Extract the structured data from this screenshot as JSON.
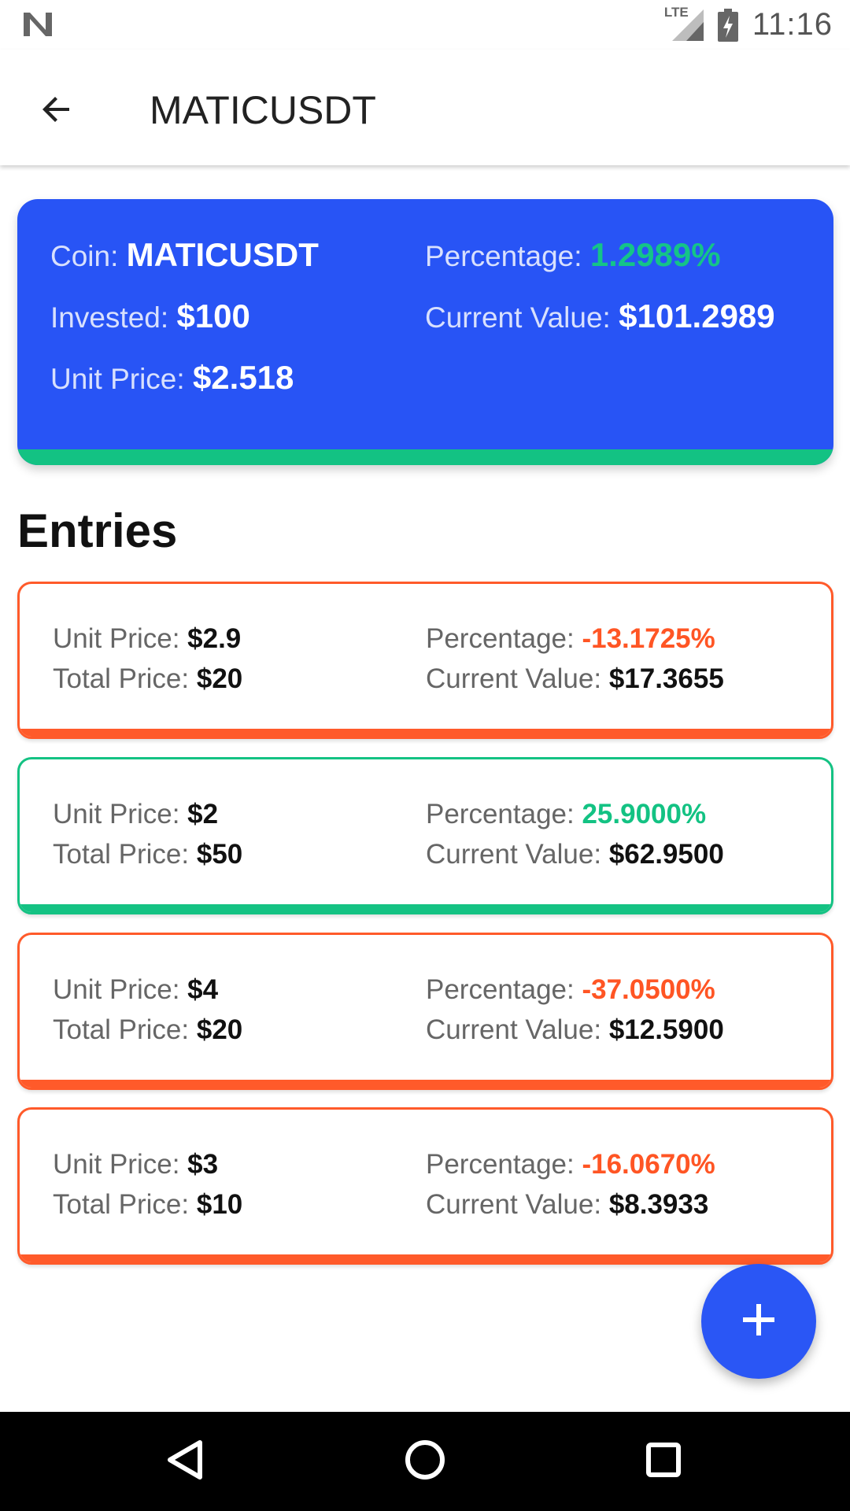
{
  "status_bar": {
    "time": "11:16",
    "network_label": "LTE",
    "icons": [
      "n-logo-icon",
      "signal-icon",
      "battery-charging-icon"
    ]
  },
  "app_bar": {
    "title": "MATICUSDT",
    "back_icon": "arrow-back-icon"
  },
  "summary": {
    "coin_label": "Coin: ",
    "coin_value": "MATICUSDT",
    "percentage_label": "Percentage: ",
    "percentage_value": "1.2989%",
    "invested_label": "Invested: ",
    "invested_value": "$100",
    "current_value_label": "Current Value: ",
    "current_value_value": "$101.2989",
    "unit_price_label": "Unit Price: ",
    "unit_price_value": "$2.518"
  },
  "entries_heading": "Entries",
  "entries": [
    {
      "unit_price_label": "Unit Price: ",
      "unit_price": "$2.9",
      "total_price_label": "Total Price: ",
      "total_price": "$20",
      "percentage_label": "Percentage: ",
      "percentage": "-13.1725%",
      "current_value_label": "Current Value: ",
      "current_value": "$17.3655"
    },
    {
      "unit_price_label": "Unit Price: ",
      "unit_price": "$2",
      "total_price_label": "Total Price: ",
      "total_price": "$50",
      "percentage_label": "Percentage: ",
      "percentage": "25.9000%",
      "current_value_label": "Current Value: ",
      "current_value": "$62.9500"
    },
    {
      "unit_price_label": "Unit Price: ",
      "unit_price": "$4",
      "total_price_label": "Total Price: ",
      "total_price": "$20",
      "percentage_label": "Percentage: ",
      "percentage": "-37.0500%",
      "current_value_label": "Current Value: ",
      "current_value": "$12.5900"
    },
    {
      "unit_price_label": "Unit Price: ",
      "unit_price": "$3",
      "total_price_label": "Total Price: ",
      "total_price": "$10",
      "percentage_label": "Percentage: ",
      "percentage": "-16.0670%",
      "current_value_label": "Current Value: ",
      "current_value": "$8.3933"
    }
  ],
  "fab": {
    "icon": "plus-icon"
  },
  "nav_bar": {
    "icons": [
      "nav-back-icon",
      "nav-home-icon",
      "nav-recents-icon"
    ]
  },
  "colors": {
    "primary": "#2854f5",
    "gain": "#14c283",
    "loss": "#ff5524"
  }
}
